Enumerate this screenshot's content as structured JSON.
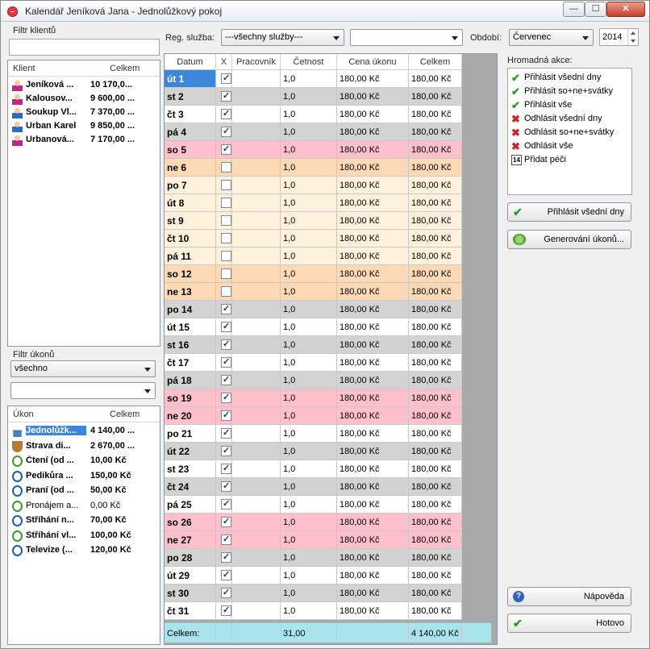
{
  "window": {
    "title": "Kalendář Jeníková Jana - Jednolůžkový pokoj",
    "min": "—",
    "max": "☐",
    "close": "✕"
  },
  "client_filter": {
    "label": "Filtr klientů",
    "value": ""
  },
  "clients": {
    "col_name": "Klient",
    "col_total": "Celkem",
    "items": [
      {
        "name": "Jeníková ...",
        "total": "10 170,0...",
        "gender": "f"
      },
      {
        "name": "Kalousov...",
        "total": "9 600,00 ...",
        "gender": "f"
      },
      {
        "name": "Soukup Vl...",
        "total": "7 370,00 ...",
        "gender": "m"
      },
      {
        "name": "Urban Karel",
        "total": "9 850,00 ...",
        "gender": "m"
      },
      {
        "name": "Urbanová...",
        "total": "7 170,00 ...",
        "gender": "f"
      }
    ]
  },
  "service_filter": {
    "label": "Filtr úkonů",
    "selected": "všechno",
    "second": ""
  },
  "services": {
    "col_name": "Úkon",
    "col_total": "Celkem",
    "items": [
      {
        "name": "Jednolůžk...",
        "total": "4 140,00 ...",
        "icon": "house-icon",
        "selected": true,
        "bold": true
      },
      {
        "name": "Strava di...",
        "total": "2 670,00 ...",
        "icon": "bowl-icon",
        "selected": false,
        "bold": true
      },
      {
        "name": "Čtení (od ...",
        "total": "10,00 Kč",
        "icon": "clock-green-icon",
        "selected": false,
        "bold": true
      },
      {
        "name": "Pedikůra ...",
        "total": "150,00 Kč",
        "icon": "clock-blue-icon",
        "selected": false,
        "bold": true
      },
      {
        "name": "Praní (od ...",
        "total": "50,00 Kč",
        "icon": "clock-blue-icon",
        "selected": false,
        "bold": true
      },
      {
        "name": "Pronájem a...",
        "total": "0,00 Kč",
        "icon": "clock-green-icon",
        "selected": false,
        "bold": false
      },
      {
        "name": "Stříhání n...",
        "total": "70,00 Kč",
        "icon": "clock-blue-icon",
        "selected": false,
        "bold": true
      },
      {
        "name": "Stříhání vl...",
        "total": "100,00 Kč",
        "icon": "clock-green-icon",
        "selected": false,
        "bold": true
      },
      {
        "name": "Televize (...",
        "total": "120,00 Kč",
        "icon": "clock-blue-icon",
        "selected": false,
        "bold": true
      }
    ]
  },
  "toolbar": {
    "service_label": "Reg. služba:",
    "service_value": "---všechny služby---",
    "second_value": "",
    "period_label": "Období:",
    "month": "Červenec",
    "year": "2014"
  },
  "grid": {
    "headers": [
      "Datum",
      "X",
      "Pracovník",
      "Četnost",
      "Cena úkonu",
      "Celkem"
    ],
    "rows": [
      {
        "day": "út 1",
        "checked": true,
        "worker": "",
        "count": "1,0",
        "price": "180,00 Kč",
        "total": "180,00 Kč",
        "kind": "sel"
      },
      {
        "day": "st 2",
        "checked": true,
        "worker": "",
        "count": "1,0",
        "price": "180,00 Kč",
        "total": "180,00 Kč",
        "kind": "gray"
      },
      {
        "day": "čt 3",
        "checked": true,
        "worker": "",
        "count": "1,0",
        "price": "180,00 Kč",
        "total": "180,00 Kč",
        "kind": "white"
      },
      {
        "day": "pá 4",
        "checked": true,
        "worker": "",
        "count": "1,0",
        "price": "180,00 Kč",
        "total": "180,00 Kč",
        "kind": "gray"
      },
      {
        "day": "so 5",
        "checked": true,
        "worker": "",
        "count": "1,0",
        "price": "180,00 Kč",
        "total": "180,00 Kč",
        "kind": "pink"
      },
      {
        "day": "ne 6",
        "checked": false,
        "worker": "",
        "count": "1,0",
        "price": "180,00 Kč",
        "total": "180,00 Kč",
        "kind": "peach"
      },
      {
        "day": "po 7",
        "checked": false,
        "worker": "",
        "count": "1,0",
        "price": "180,00 Kč",
        "total": "180,00 Kč",
        "kind": "cream"
      },
      {
        "day": "út 8",
        "checked": false,
        "worker": "",
        "count": "1,0",
        "price": "180,00 Kč",
        "total": "180,00 Kč",
        "kind": "cream"
      },
      {
        "day": "st 9",
        "checked": false,
        "worker": "",
        "count": "1,0",
        "price": "180,00 Kč",
        "total": "180,00 Kč",
        "kind": "cream"
      },
      {
        "day": "čt 10",
        "checked": false,
        "worker": "",
        "count": "1,0",
        "price": "180,00 Kč",
        "total": "180,00 Kč",
        "kind": "cream"
      },
      {
        "day": "pá 11",
        "checked": false,
        "worker": "",
        "count": "1,0",
        "price": "180,00 Kč",
        "total": "180,00 Kč",
        "kind": "cream"
      },
      {
        "day": "so 12",
        "checked": false,
        "worker": "",
        "count": "1,0",
        "price": "180,00 Kč",
        "total": "180,00 Kč",
        "kind": "peach"
      },
      {
        "day": "ne 13",
        "checked": false,
        "worker": "",
        "count": "1,0",
        "price": "180,00 Kč",
        "total": "180,00 Kč",
        "kind": "peach"
      },
      {
        "day": "po 14",
        "checked": true,
        "worker": "",
        "count": "1,0",
        "price": "180,00 Kč",
        "total": "180,00 Kč",
        "kind": "gray"
      },
      {
        "day": "út 15",
        "checked": true,
        "worker": "",
        "count": "1,0",
        "price": "180,00 Kč",
        "total": "180,00 Kč",
        "kind": "white"
      },
      {
        "day": "st 16",
        "checked": true,
        "worker": "",
        "count": "1,0",
        "price": "180,00 Kč",
        "total": "180,00 Kč",
        "kind": "gray"
      },
      {
        "day": "čt 17",
        "checked": true,
        "worker": "",
        "count": "1,0",
        "price": "180,00 Kč",
        "total": "180,00 Kč",
        "kind": "white"
      },
      {
        "day": "pá 18",
        "checked": true,
        "worker": "",
        "count": "1,0",
        "price": "180,00 Kč",
        "total": "180,00 Kč",
        "kind": "gray"
      },
      {
        "day": "so 19",
        "checked": true,
        "worker": "",
        "count": "1,0",
        "price": "180,00 Kč",
        "total": "180,00 Kč",
        "kind": "pink"
      },
      {
        "day": "ne 20",
        "checked": true,
        "worker": "",
        "count": "1,0",
        "price": "180,00 Kč",
        "total": "180,00 Kč",
        "kind": "pink"
      },
      {
        "day": "po 21",
        "checked": true,
        "worker": "",
        "count": "1,0",
        "price": "180,00 Kč",
        "total": "180,00 Kč",
        "kind": "white"
      },
      {
        "day": "út 22",
        "checked": true,
        "worker": "",
        "count": "1,0",
        "price": "180,00 Kč",
        "total": "180,00 Kč",
        "kind": "gray"
      },
      {
        "day": "st 23",
        "checked": true,
        "worker": "",
        "count": "1,0",
        "price": "180,00 Kč",
        "total": "180,00 Kč",
        "kind": "white"
      },
      {
        "day": "čt 24",
        "checked": true,
        "worker": "",
        "count": "1,0",
        "price": "180,00 Kč",
        "total": "180,00 Kč",
        "kind": "gray"
      },
      {
        "day": "pá 25",
        "checked": true,
        "worker": "",
        "count": "1,0",
        "price": "180,00 Kč",
        "total": "180,00 Kč",
        "kind": "white"
      },
      {
        "day": "so 26",
        "checked": true,
        "worker": "",
        "count": "1,0",
        "price": "180,00 Kč",
        "total": "180,00 Kč",
        "kind": "pink"
      },
      {
        "day": "ne 27",
        "checked": true,
        "worker": "",
        "count": "1,0",
        "price": "180,00 Kč",
        "total": "180,00 Kč",
        "kind": "pink"
      },
      {
        "day": "po 28",
        "checked": true,
        "worker": "",
        "count": "1,0",
        "price": "180,00 Kč",
        "total": "180,00 Kč",
        "kind": "gray"
      },
      {
        "day": "út 29",
        "checked": true,
        "worker": "",
        "count": "1,0",
        "price": "180,00 Kč",
        "total": "180,00 Kč",
        "kind": "white"
      },
      {
        "day": "st 30",
        "checked": true,
        "worker": "",
        "count": "1,0",
        "price": "180,00 Kč",
        "total": "180,00 Kč",
        "kind": "gray"
      },
      {
        "day": "čt 31",
        "checked": true,
        "worker": "",
        "count": "1,0",
        "price": "180,00 Kč",
        "total": "180,00 Kč",
        "kind": "white"
      }
    ],
    "footer": {
      "label": "Celkem:",
      "count": "31,00",
      "total": "4 140,00 Kč"
    }
  },
  "bulk": {
    "label": "Hromadná akce:",
    "items": [
      {
        "text": "Přihlásit všední dny",
        "icon": "check-icon"
      },
      {
        "text": "Přihlásit so+ne+svátky",
        "icon": "check-icon"
      },
      {
        "text": "Přihlásit vše",
        "icon": "check-icon"
      },
      {
        "text": "Odhlásit všední dny",
        "icon": "cross-icon"
      },
      {
        "text": "Odhlásit so+ne+svátky",
        "icon": "cross-icon"
      },
      {
        "text": "Odhlásit vše",
        "icon": "cross-icon"
      },
      {
        "text": "Přidat péči",
        "icon": "calendar-icon"
      }
    ]
  },
  "buttons": {
    "weekdays": "Přihlásit všední dny",
    "generate": "Generování úkonů...",
    "help": "Nápověda",
    "done": "Hotovo"
  },
  "colors": {
    "sel": "#3b87d9",
    "white": "#ffffff",
    "gray": "#d3d3d3",
    "pink": "#ffc0cb",
    "peach": "#fdd9b5",
    "cream": "#fff1dc",
    "footer": "#a9e4ec"
  }
}
